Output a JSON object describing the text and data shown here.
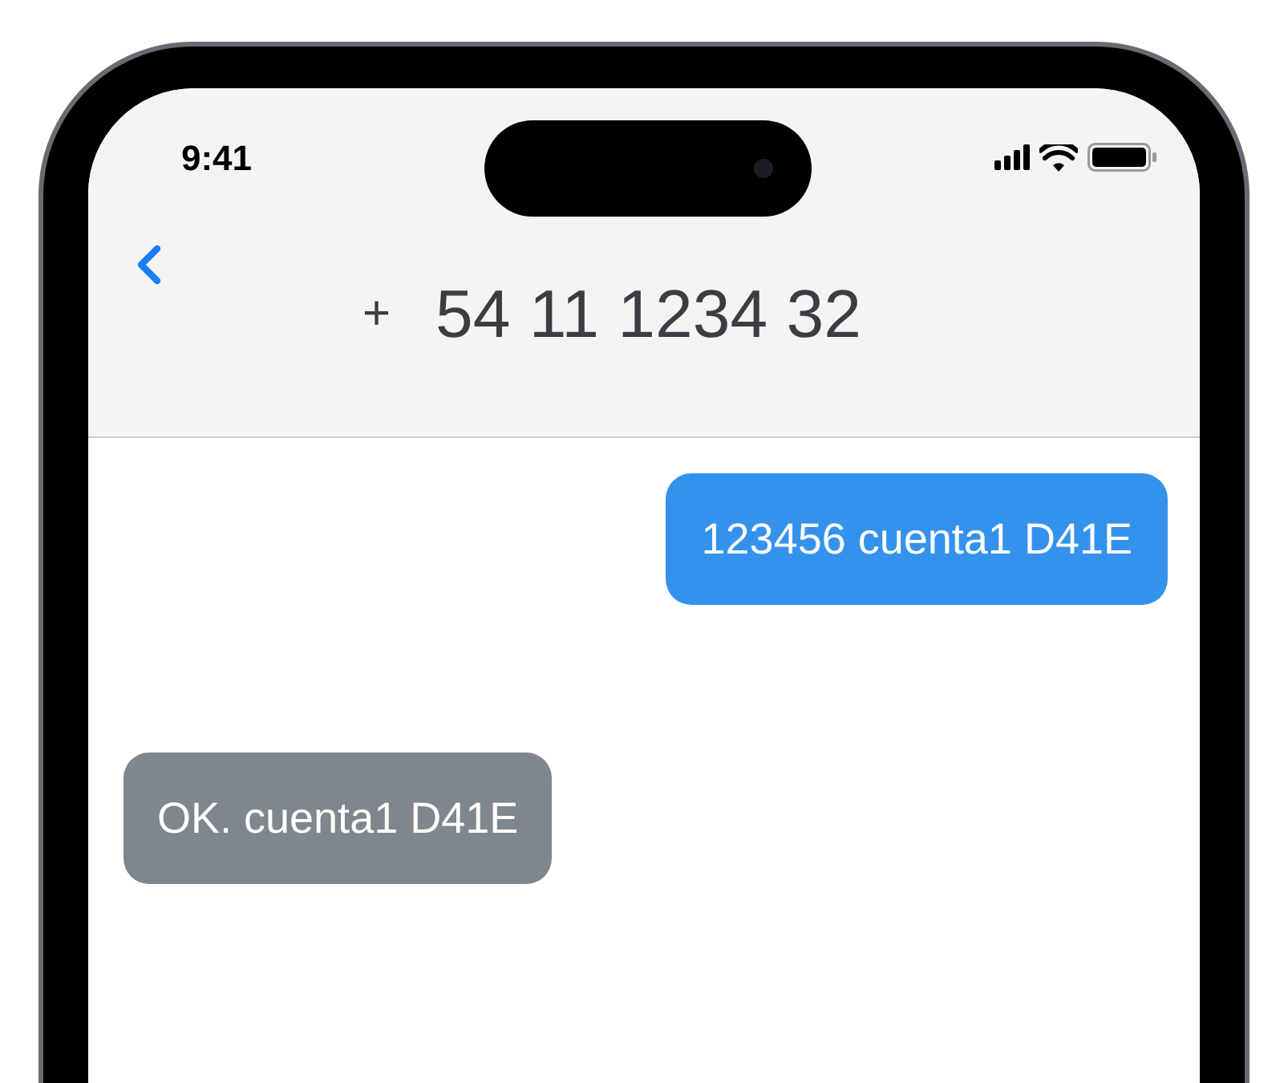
{
  "status_bar": {
    "time": "9:41"
  },
  "header": {
    "prefix": "+",
    "number": "54 11 1234 32"
  },
  "messages": [
    {
      "kind": "sent",
      "text": "123456 cuenta1 D41E"
    },
    {
      "kind": "received",
      "text": "OK. cuenta1 D41E"
    }
  ]
}
